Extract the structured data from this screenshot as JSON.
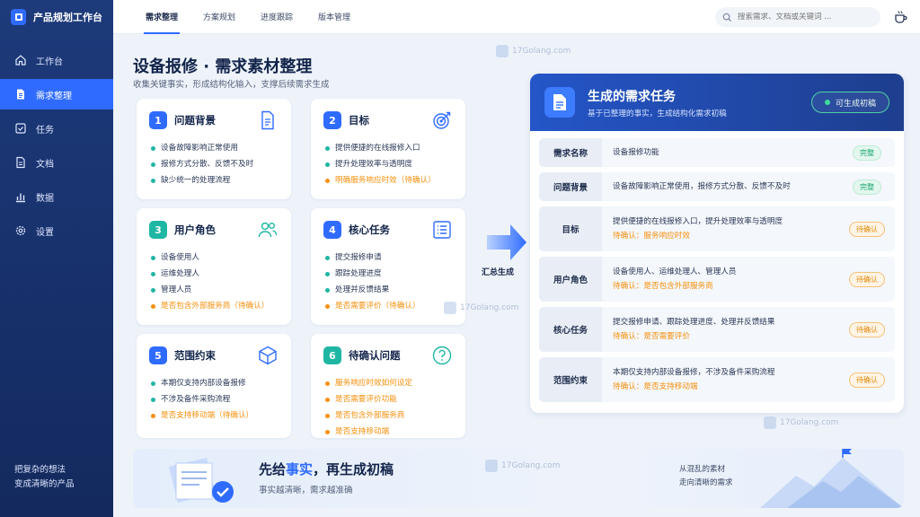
{
  "app": {
    "title": "产品规划工作台",
    "slogan_line1": "把复杂的想法",
    "slogan_line2": "变成清晰的产品"
  },
  "sidebar": {
    "items": [
      {
        "label": "工作台",
        "icon": "home-icon"
      },
      {
        "label": "需求整理",
        "icon": "document-icon",
        "active": true
      },
      {
        "label": "任务",
        "icon": "checkbox-icon"
      },
      {
        "label": "文档",
        "icon": "file-icon"
      },
      {
        "label": "数据",
        "icon": "bar-chart-icon"
      },
      {
        "label": "设置",
        "icon": "gear-icon"
      }
    ]
  },
  "topbar": {
    "tabs": [
      "需求整理",
      "方案规划",
      "进度跟踪",
      "版本管理"
    ],
    "search_placeholder": "搜索需求、文档或关键词 ..."
  },
  "page": {
    "title": "设备报修 · 需求素材整理",
    "subtitle": "收集关键事实，形成结构化输入，支撑后续需求生成"
  },
  "cards": [
    {
      "num": "1",
      "title": "问题背景",
      "icon": "document-icon",
      "items": [
        {
          "text": "设备故障影响正常使用",
          "pending": false
        },
        {
          "text": "报修方式分散、反馈不及时",
          "pending": false
        },
        {
          "text": "缺少统一的处理流程",
          "pending": false
        }
      ]
    },
    {
      "num": "2",
      "title": "目标",
      "icon": "target-icon",
      "items": [
        {
          "text": "提供便捷的在线报修入口",
          "pending": false
        },
        {
          "text": "提升处理效率与透明度",
          "pending": false
        },
        {
          "text": "明确服务响应时效（待确认）",
          "pending": true
        }
      ]
    },
    {
      "num": "3",
      "title": "用户角色",
      "icon": "users-icon",
      "items": [
        {
          "text": "设备使用人",
          "pending": false
        },
        {
          "text": "运维处理人",
          "pending": false
        },
        {
          "text": "管理人员",
          "pending": false
        },
        {
          "text": "是否包含外部服务商（待确认）",
          "pending": true
        }
      ]
    },
    {
      "num": "4",
      "title": "核心任务",
      "icon": "list-icon",
      "items": [
        {
          "text": "提交报修申请",
          "pending": false
        },
        {
          "text": "跟踪处理进度",
          "pending": false
        },
        {
          "text": "处理并反馈结果",
          "pending": false
        },
        {
          "text": "是否需要评价（待确认）",
          "pending": true
        }
      ]
    },
    {
      "num": "5",
      "title": "范围约束",
      "icon": "cube-icon",
      "items": [
        {
          "text": "本期仅支持内部设备报修",
          "pending": false
        },
        {
          "text": "不涉及备件采购流程",
          "pending": false
        },
        {
          "text": "是否支持移动端（待确认）",
          "pending": true
        }
      ]
    },
    {
      "num": "6",
      "title": "待确认问题",
      "icon": "question-icon",
      "items": [
        {
          "text": "服务响应时效如何设定",
          "pending": true
        },
        {
          "text": "是否需要评价功能",
          "pending": true
        },
        {
          "text": "是否包含外部服务商",
          "pending": true
        },
        {
          "text": "是否支持移动端",
          "pending": true
        }
      ]
    }
  ],
  "arrow": {
    "label": "汇总生成"
  },
  "panel": {
    "title": "生成的需求任务",
    "subtitle": "基于已整理的事实，生成结构化需求初稿",
    "button": "可生成初稿",
    "rows": [
      {
        "label": "需求名称",
        "text": "设备报修功能",
        "pending": "",
        "status": "完整",
        "status_type": "ok"
      },
      {
        "label": "问题背景",
        "text": "设备故障影响正常使用，报修方式分散、反馈不及时",
        "pending": "",
        "status": "完整",
        "status_type": "ok"
      },
      {
        "label": "目标",
        "text": "提供便捷的在线报修入口，提升处理效率与透明度",
        "pending": "待确认：服务响应时效",
        "status": "待确认",
        "status_type": "wait"
      },
      {
        "label": "用户角色",
        "text": "设备使用人、运维处理人、管理人员",
        "pending": "待确认：是否包含外部服务商",
        "status": "待确认",
        "status_type": "wait"
      },
      {
        "label": "核心任务",
        "text": "提交报修申请、跟踪处理进度、处理并反馈结果",
        "pending": "待确认：是否需要评价",
        "status": "待确认",
        "status_type": "wait"
      },
      {
        "label": "范围约束",
        "text": "本期仅支持内部设备报修，不涉及备件采购流程",
        "pending": "待确认：是否支持移动端",
        "status": "待确认",
        "status_type": "wait"
      }
    ]
  },
  "banner": {
    "title_a": "先给",
    "title_hl": "事实",
    "title_b": "，再生成初稿",
    "subtitle": "事实越清晰，需求越准确",
    "right_line1": "从混乱的素材",
    "right_line2": "走向清晰的需求"
  },
  "watermark": "17Golang.com",
  "colors": {
    "accent": "#2f6bff",
    "teal": "#1fb6a4",
    "pending": "#f5900d",
    "sidebar": "#1d3a7a"
  }
}
